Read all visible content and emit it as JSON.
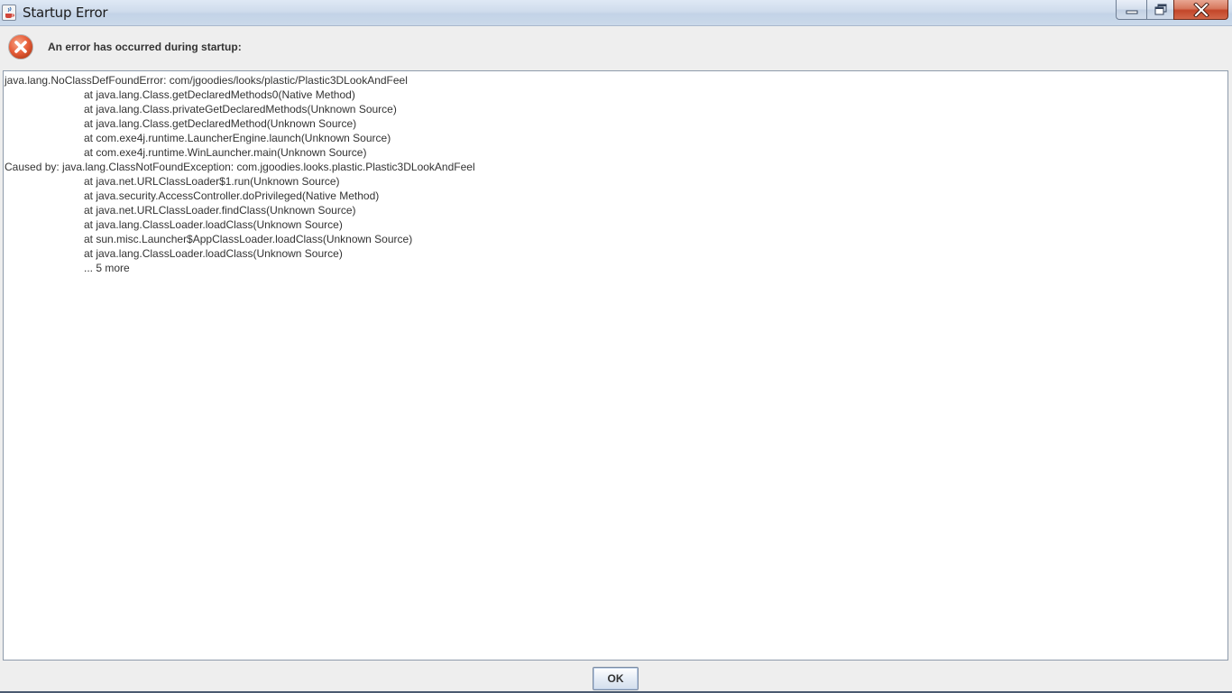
{
  "window": {
    "title": "Startup Error",
    "icons": {
      "app": "java-cup-icon",
      "minimize": "minimize-icon",
      "maximize": "restore-icon",
      "close": "close-icon"
    }
  },
  "header": {
    "icon": "error-icon",
    "message": "An error has occurred during startup:"
  },
  "trace": {
    "lines": [
      {
        "text": "java.lang.NoClassDefFoundError: com/jgoodies/looks/plastic/Plastic3DLookAndFeel",
        "indent": false
      },
      {
        "text": "at java.lang.Class.getDeclaredMethods0(Native Method)",
        "indent": true
      },
      {
        "text": "at java.lang.Class.privateGetDeclaredMethods(Unknown Source)",
        "indent": true
      },
      {
        "text": "at java.lang.Class.getDeclaredMethod(Unknown Source)",
        "indent": true
      },
      {
        "text": "at com.exe4j.runtime.LauncherEngine.launch(Unknown Source)",
        "indent": true
      },
      {
        "text": "at com.exe4j.runtime.WinLauncher.main(Unknown Source)",
        "indent": true
      },
      {
        "text": "Caused by: java.lang.ClassNotFoundException: com.jgoodies.looks.plastic.Plastic3DLookAndFeel",
        "indent": false
      },
      {
        "text": "at java.net.URLClassLoader$1.run(Unknown Source)",
        "indent": true
      },
      {
        "text": "at java.security.AccessController.doPrivileged(Native Method)",
        "indent": true
      },
      {
        "text": "at java.net.URLClassLoader.findClass(Unknown Source)",
        "indent": true
      },
      {
        "text": "at java.lang.ClassLoader.loadClass(Unknown Source)",
        "indent": true
      },
      {
        "text": "at sun.misc.Launcher$AppClassLoader.loadClass(Unknown Source)",
        "indent": true
      },
      {
        "text": "at java.lang.ClassLoader.loadClass(Unknown Source)",
        "indent": true
      },
      {
        "text": "... 5 more",
        "indent": true
      }
    ]
  },
  "footer": {
    "ok_label": "OK"
  },
  "colors": {
    "error_red": "#e8603c",
    "close_button": "#c3462a",
    "titlebar": "#cfdcec",
    "text": "#333333"
  }
}
